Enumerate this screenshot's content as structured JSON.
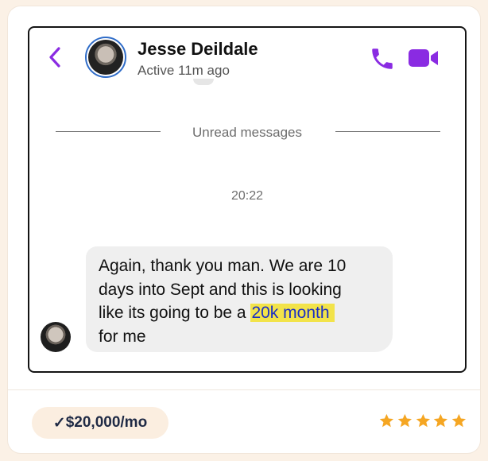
{
  "header": {
    "contact_name": "Jesse Deildale",
    "status": "Active 11m ago",
    "back_icon": "chevron-left-icon",
    "call_icon": "phone-icon",
    "video_icon": "video-camera-icon",
    "accent_color": "#8a2be2"
  },
  "thread": {
    "divider_label": "Unread messages",
    "timestamp": "20:22",
    "message_line1": "Again, thank you man. We are 10",
    "message_line2": "days into Sept and this is looking",
    "message_line3_prefix": "like its going to be a ",
    "message_highlight": "20k month",
    "message_line4": "for me",
    "highlight_color": "#f2e34a"
  },
  "footer": {
    "badge_check": "✓",
    "badge_text": "$20,000/mo",
    "rating": 5,
    "rating_max": 5,
    "star_color": "#f5a623"
  }
}
